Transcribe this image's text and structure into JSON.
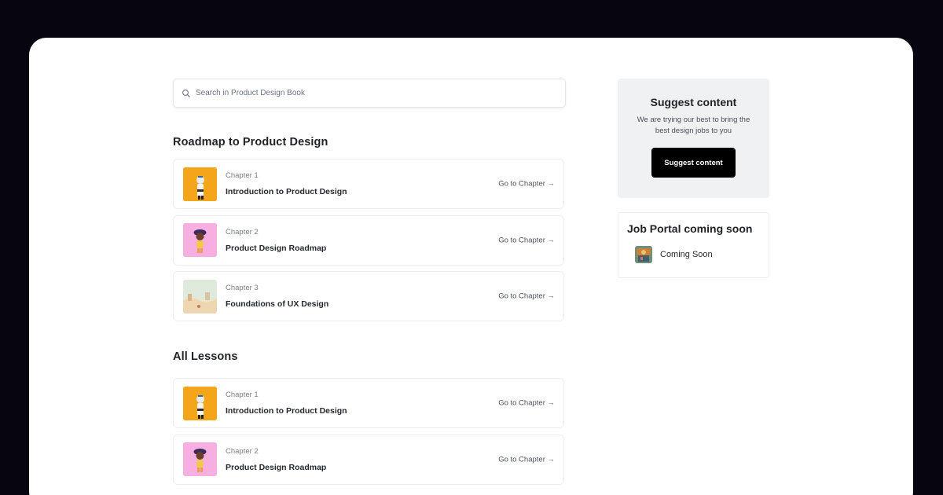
{
  "search": {
    "placeholder": "Search in Product Design Book"
  },
  "roadmap": {
    "title": "Roadmap to Product Design",
    "chapters": [
      {
        "number": "Chapter 1",
        "title": "Introduction to Product Design",
        "link": "Go to Chapter →",
        "thumb_color": "#f4a519"
      },
      {
        "number": "Chapter 2",
        "title": "Product Design Roadmap",
        "link": "Go to Chapter →",
        "thumb_color": "#f7aee0"
      },
      {
        "number": "Chapter 3",
        "title": "Foundations of UX Design",
        "link": "Go to Chapter →",
        "thumb_color": "#e4e8d6"
      }
    ]
  },
  "lessons": {
    "title": "All Lessons",
    "chapters": [
      {
        "number": "Chapter 1",
        "title": "Introduction to Product Design",
        "link": "Go to Chapter →",
        "thumb_color": "#f4a519"
      },
      {
        "number": "Chapter 2",
        "title": "Product Design Roadmap",
        "link": "Go to Chapter →",
        "thumb_color": "#f7aee0"
      }
    ]
  },
  "suggest": {
    "title": "Suggest content",
    "text": "We are trying our best to bring the best design jobs to you",
    "button": "Suggest content"
  },
  "jobs": {
    "title": "Job Portal coming soon",
    "item": "Coming Soon"
  },
  "colors": {
    "background": "#07050f",
    "card": "#ffffff",
    "panel": "#eff1f3",
    "button": "#000000"
  }
}
